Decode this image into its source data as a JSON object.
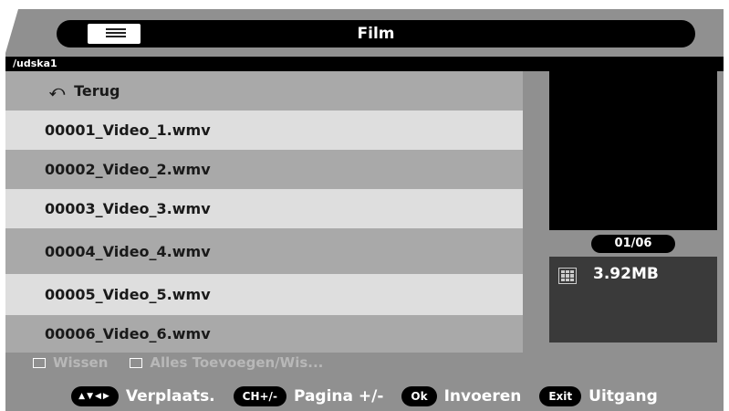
{
  "header": {
    "menu_icon": "menu-list-icon",
    "title": "Film"
  },
  "path": "/udska1",
  "list": {
    "back_label": "Terug",
    "back_icon": "return-arrow-icon",
    "items": [
      "00001_Video_1.wmv",
      "00002_Video_2.wmv",
      "00003_Video_3.wmv",
      "00004_Video_4.wmv",
      "00005_Video_5.wmv",
      "00006_Video_6.wmv"
    ]
  },
  "info": {
    "page": "01/06",
    "size": "3.92MB",
    "file_icon": "video-file-icon"
  },
  "options": {
    "delete_label": "Wissen",
    "add_remove_all_label": "Alles Toevoegen/Wis..."
  },
  "footer": {
    "move_key": "▲▼◀▶",
    "move_label": "Verplaats.",
    "page_key": "CH+/-",
    "page_label": "Pagina +/-",
    "ok_key": "Ok",
    "ok_label": "Invoeren",
    "exit_key": "Exit",
    "exit_label": "Uitgang"
  },
  "colors": {
    "background": "#909090",
    "row_dark": "#a9a9a9",
    "row_light": "#dedede",
    "bar": "#000000"
  }
}
